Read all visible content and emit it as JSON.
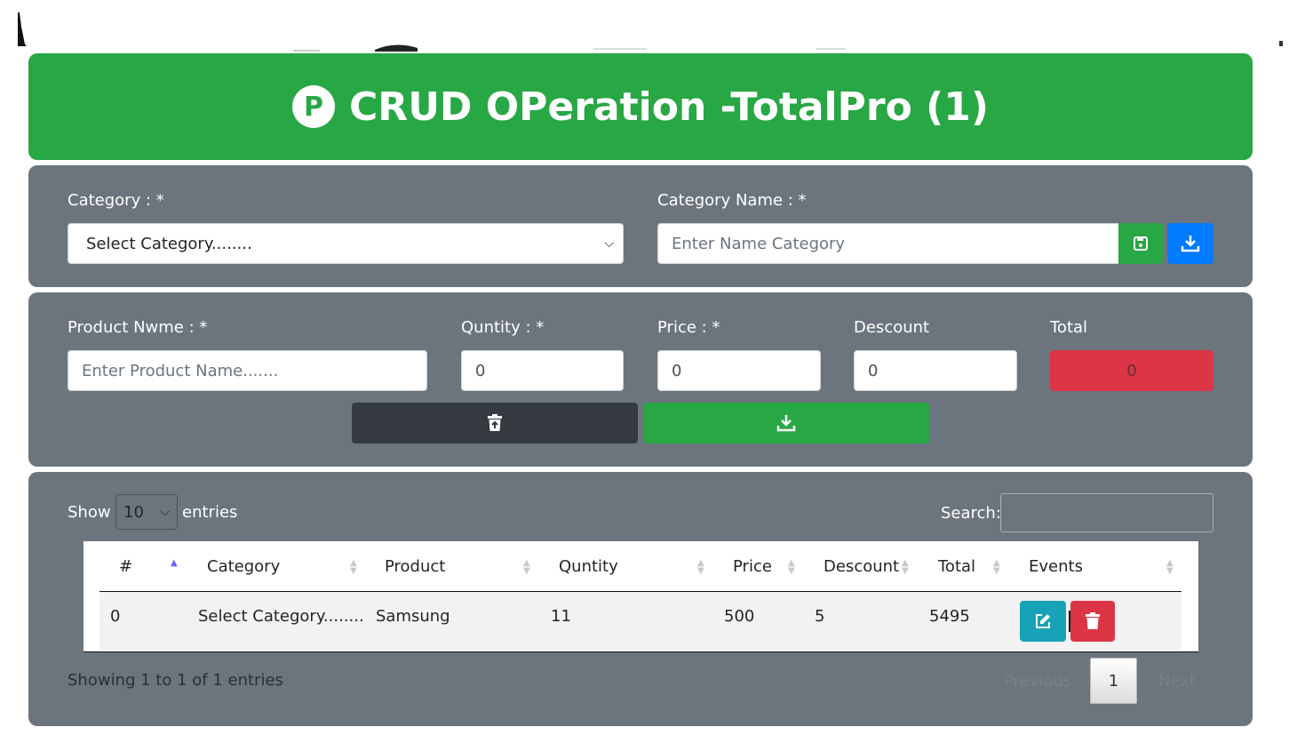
{
  "header": {
    "logo_letter": "P",
    "title": "CRUD OPeration -TotalPro (1)",
    "color": "#28a745"
  },
  "category_panel": {
    "category_label": "Category : *",
    "category_select_value": "Select Category........",
    "category_name_label": "Category Name : *",
    "category_name_placeholder": "Enter Name Category",
    "save_icon": "save-icon",
    "download_icon": "download-icon"
  },
  "product_panel": {
    "product_name_label": "Product Nwme : *",
    "product_name_placeholder": "Enter Product Name.......",
    "quantity_label": "Quntity : *",
    "quantity_value": "0",
    "price_label": "Price : *",
    "price_value": "0",
    "discount_label": "Descount",
    "discount_value": "0",
    "total_label": "Total",
    "total_value": "0"
  },
  "table_panel": {
    "show_label": "Show",
    "entries_label": "entries",
    "page_length": "10",
    "search_label": "Search:",
    "columns": [
      "#",
      "Category",
      "Product",
      "Quntity",
      "Price",
      "Descount",
      "Total",
      "Events"
    ],
    "rows": [
      {
        "id": "0",
        "category": "Select Category........",
        "product": "Samsung",
        "quantity": "11",
        "price": "500",
        "discount": "5",
        "total": "5495"
      }
    ],
    "info": "Showing 1 to 1 of 1 entries",
    "previous_label": "Previous",
    "current_page": "1",
    "next_label": "Next"
  }
}
